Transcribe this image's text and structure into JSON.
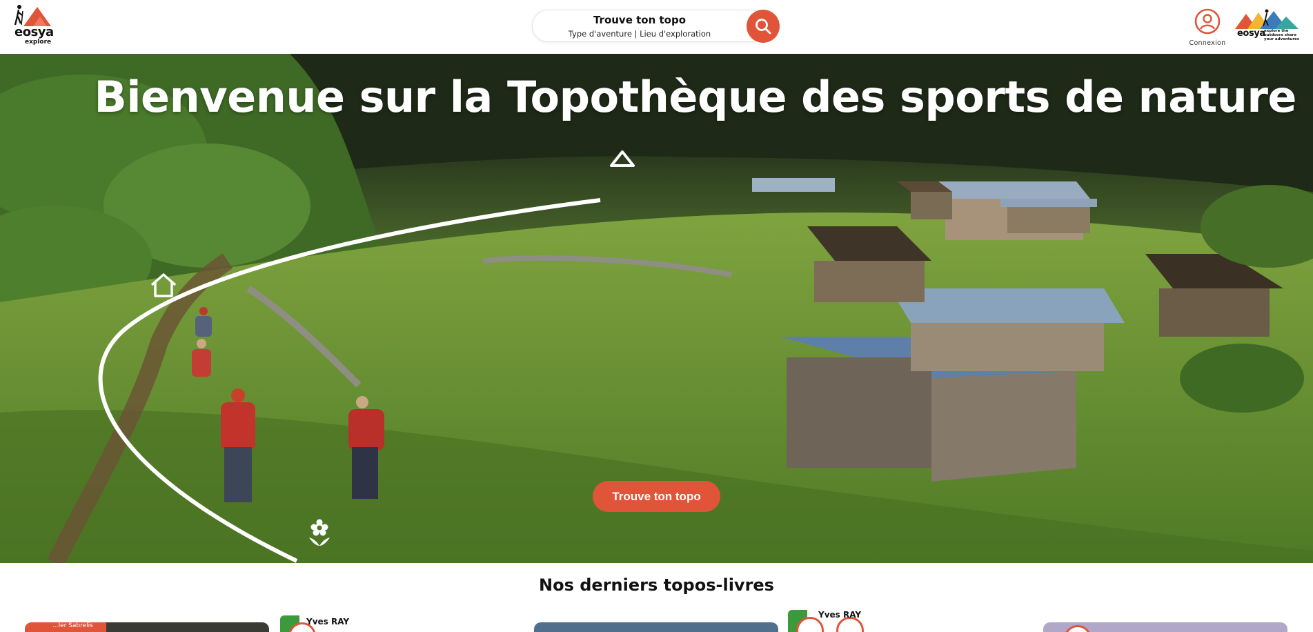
{
  "header": {
    "logo_left": {
      "brand": "eosya",
      "sub": "explore"
    },
    "search": {
      "title": "Trouve ton topo",
      "subtitle": "Type d'aventure  |  Lieu d'exploration",
      "button_icon": "search-icon"
    },
    "account": {
      "label": "Connexion",
      "icon": "user-icon"
    },
    "logo_right": {
      "brand": "eosya",
      "tagline": "explore the outdoors share your adventures"
    }
  },
  "hero": {
    "title": "Bienvenue sur la Topothèque des sports de nature",
    "cta_label": "Trouve ton topo",
    "icons": [
      "home-icon",
      "mountain-icon",
      "flower-icon"
    ]
  },
  "section": {
    "title": "Nos derniers topos-livres",
    "cards": [
      {
        "tag": "...ler Sabrelis",
        "author": ""
      },
      {
        "tag": "",
        "author": "Yves RAY"
      },
      {
        "tag": "",
        "author": "Yves RAY"
      }
    ]
  },
  "colors": {
    "accent": "#e0553a",
    "badge_green": "#3c9a3c"
  }
}
